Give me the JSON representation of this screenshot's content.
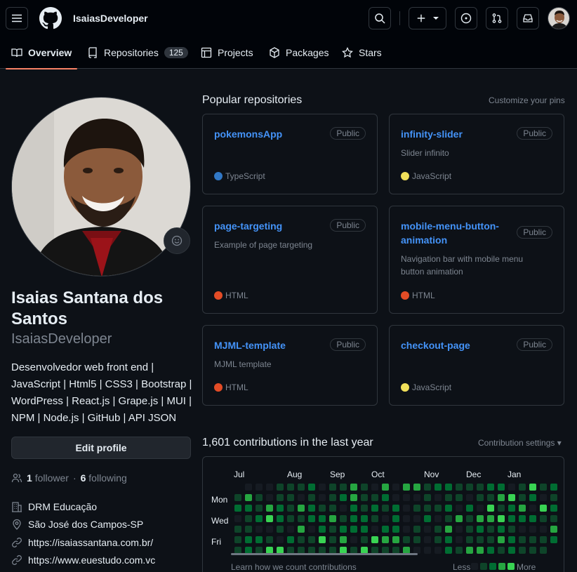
{
  "header": {
    "username": "IsaiasDeveloper",
    "icons": [
      "menu-icon",
      "github-logo-icon",
      "search-icon",
      "plus-icon",
      "issues-icon",
      "pull-request-icon",
      "inbox-icon"
    ]
  },
  "tabs": [
    {
      "label": "Overview",
      "icon": "book-icon",
      "active": true
    },
    {
      "label": "Repositories",
      "icon": "repo-icon",
      "count": "125"
    },
    {
      "label": "Projects",
      "icon": "table-icon"
    },
    {
      "label": "Packages",
      "icon": "package-icon"
    },
    {
      "label": "Stars",
      "icon": "star-icon"
    }
  ],
  "profile": {
    "full_name": "Isaias Santana dos Santos",
    "login": "IsaiasDeveloper",
    "bio": "Desenvolvedor web front end | JavaScript | Html5 | CSS3 | Bootstrap | WordPress | React.js | Grape.js | MUI | NPM | Node.js | GitHub | API JSON",
    "edit_label": "Edit profile",
    "followers_count": "1",
    "followers_label": "follower",
    "following_count": "6",
    "following_label": "following",
    "separator": "·",
    "organization": "DRM Educação",
    "location": "São José dos Campos-SP",
    "links": [
      "https://isaiassantana.com.br/",
      "https://www.euestudo.com.vc"
    ]
  },
  "popular": {
    "title": "Popular repositories",
    "customize": "Customize your pins",
    "repos": [
      {
        "name": "pokemonsApp",
        "visibility": "Public",
        "description": "",
        "language": "TypeScript",
        "color": "#3178c6"
      },
      {
        "name": "infinity-slider",
        "visibility": "Public",
        "description": "Slider infinito",
        "language": "JavaScript",
        "color": "#f1e05a"
      },
      {
        "name": "page-targeting",
        "visibility": "Public",
        "description": "Example of page targeting",
        "language": "HTML",
        "color": "#e34c26"
      },
      {
        "name": "mobile-menu-button-animation",
        "visibility": "Public",
        "description": "Navigation bar with mobile menu button animation",
        "language": "HTML",
        "color": "#e34c26"
      },
      {
        "name": "MJML-template",
        "visibility": "Public",
        "description": "MJML template",
        "language": "HTML",
        "color": "#e34c26"
      },
      {
        "name": "checkout-page",
        "visibility": "Public",
        "description": "",
        "language": "JavaScript",
        "color": "#f1e05a"
      }
    ]
  },
  "contributions": {
    "title": "1,601 contributions in the last year",
    "settings": "Contribution settings",
    "months": [
      "Jul",
      "Aug",
      "Sep",
      "Oct",
      "Nov",
      "Dec",
      "Jan"
    ],
    "days": [
      "Mon",
      "Wed",
      "Fri"
    ],
    "learn": "Learn how we count contributions",
    "less": "Less",
    "more": "More",
    "colors": [
      "#161b22",
      "#0e4429",
      "#006d32",
      "#26a641",
      "#39d353"
    ]
  }
}
